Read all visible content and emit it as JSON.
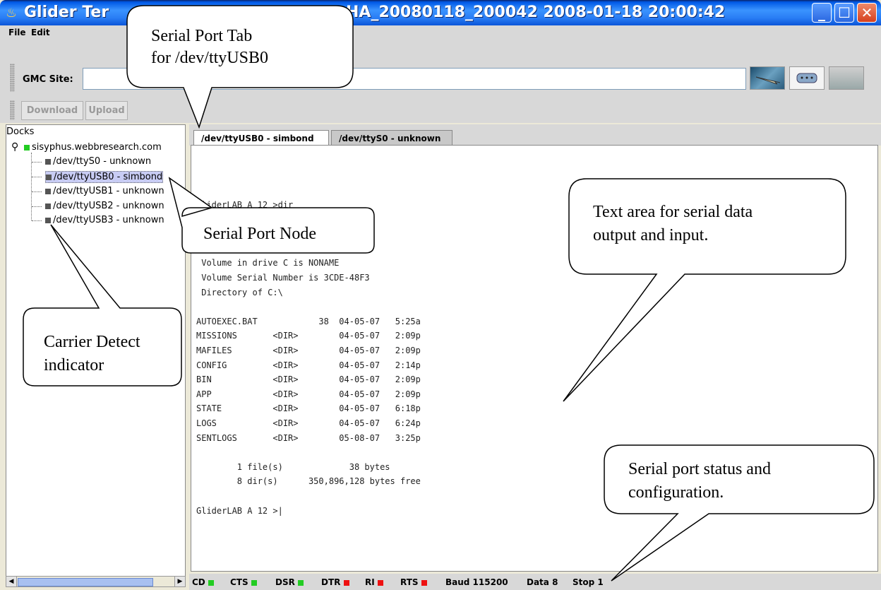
{
  "window": {
    "title": "Glider Ter",
    "title_right": "HA_20080118_200042 2008-01-18 20:00:42",
    "minimize": "_",
    "maximize": "☐",
    "close": "✕"
  },
  "menu": {
    "file": "File",
    "edit": "Edit"
  },
  "toolbar": {
    "gmc_label": "GMC Site:",
    "gmc_value": "",
    "download": "Download",
    "upload": "Upload"
  },
  "tree": {
    "root_label": "Docks",
    "host": "sisyphus.webbresearch.com",
    "nodes": [
      {
        "label": "/dev/ttyS0 - unknown",
        "cd_color": "#555555"
      },
      {
        "label": "/dev/ttyUSB0 - simbond",
        "cd_color": "#555555",
        "selected": true
      },
      {
        "label": "/dev/ttyUSB1 - unknown",
        "cd_color": "#555555"
      },
      {
        "label": "/dev/ttyUSB2 - unknown",
        "cd_color": "#555555"
      },
      {
        "label": "/dev/ttyUSB3 - unknown",
        "cd_color": "#555555"
      }
    ]
  },
  "tabs": [
    {
      "label": "/dev/ttyUSB0 - simbond",
      "active": true
    },
    {
      "label": "/dev/ttyS0 - unknown",
      "active": false
    }
  ],
  "terminal": {
    "lines": [
      "GliderLAB A 12 >dir",
      "",
      "",
      "",
      " Volume in drive C is NONAME",
      " Volume Serial Number is 3CDE-48F3",
      " Directory of C:\\",
      "",
      "AUTOEXEC.BAT            38  04-05-07   5:25a",
      "MISSIONS       <DIR>        04-05-07   2:09p",
      "MAFILES        <DIR>        04-05-07   2:09p",
      "CONFIG         <DIR>        04-05-07   2:14p",
      "BIN            <DIR>        04-05-07   2:09p",
      "APP            <DIR>        04-05-07   2:09p",
      "STATE          <DIR>        04-05-07   6:18p",
      "LOGS           <DIR>        04-05-07   6:24p",
      "SENTLOGS       <DIR>        05-08-07   3:25p",
      "",
      "        1 file(s)             38 bytes",
      "        8 dir(s)      350,896,128 bytes free",
      "",
      "GliderLAB A 12 >|"
    ]
  },
  "status": {
    "cd": "CD",
    "cd_color": "#22cc22",
    "cts": "CTS",
    "cts_color": "#22cc22",
    "dsr": "DSR",
    "dsr_color": "#22cc22",
    "dtr": "DTR",
    "dtr_color": "#ee1111",
    "ri": "RI",
    "ri_color": "#ee1111",
    "rts": "RTS",
    "rts_color": "#ee1111",
    "baud": "Baud 115200",
    "data": "Data 8",
    "stop": "Stop 1"
  },
  "callouts": {
    "serial_tab": [
      "Serial Port Tab",
      "for /dev/ttyUSB0"
    ],
    "serial_node": "Serial Port Node",
    "carrier_detect": [
      "Carrier Detect",
      "indicator"
    ],
    "text_area": [
      "Text area for serial data",
      "output and input."
    ],
    "status_config": [
      "Serial port status and",
      "configuration."
    ]
  }
}
